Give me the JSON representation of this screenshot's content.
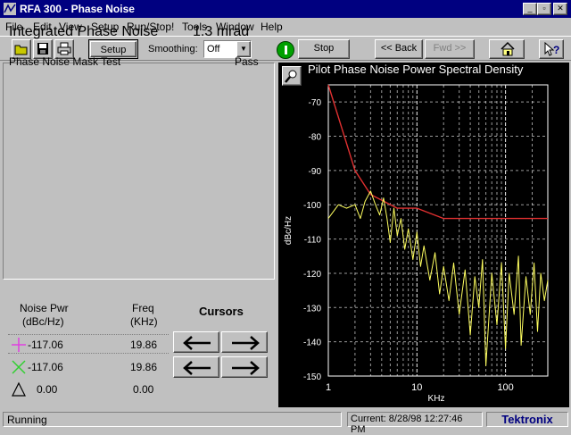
{
  "window": {
    "title": "RFA 300 - Phase Noise"
  },
  "menu": [
    "File",
    "Edit",
    "View",
    "Setup",
    "Run/Stop!",
    "Tools",
    "Window",
    "Help"
  ],
  "toolbar": {
    "setup_label": "Setup",
    "smoothing_label": "Smoothing:",
    "smoothing_value": "Off",
    "stop_label": "Stop",
    "back_label": "<< Back",
    "fwd_label": "Fwd >>"
  },
  "results": {
    "integrated_label": "Integrated Phase Noise",
    "integrated_value": "1.3 mrad",
    "mask_label": "Phase Noise Mask Test",
    "mask_result": "Pass"
  },
  "cursors": {
    "col_noise_line1": "Noise Pwr",
    "col_noise_line2": "(dBc/Hz)",
    "col_freq_line1": "Freq",
    "col_freq_line2": "(KHz)",
    "title": "Cursors",
    "rows": [
      {
        "marker": "plus",
        "noise": "-117.06",
        "freq": "19.86"
      },
      {
        "marker": "x",
        "noise": "-117.06",
        "freq": "19.86"
      },
      {
        "marker": "delta",
        "noise": "0.00",
        "freq": "0.00"
      }
    ]
  },
  "status": {
    "text": "Running",
    "current": "Current: 8/28/98 12:27:46 PM",
    "brand": "Tektronix"
  },
  "colors": {
    "titlebar": "#000080",
    "mask": "#e03030",
    "trace": "#ffff60",
    "grid": "#ffffff"
  },
  "chart_data": {
    "type": "line",
    "title": "Pilot Phase Noise Power Spectral Density",
    "xlabel": "KHz",
    "ylabel": "dBc/Hz",
    "xscale": "log",
    "xlim": [
      1,
      300
    ],
    "ylim": [
      -150,
      -65
    ],
    "xticks": [
      "1",
      "10",
      "100"
    ],
    "yticks": [
      -70,
      -80,
      -90,
      -100,
      -110,
      -120,
      -130,
      -140,
      -150
    ],
    "series": [
      {
        "points": [
          [
            1,
            -65
          ],
          [
            2,
            -90
          ],
          [
            3,
            -97
          ],
          [
            6,
            -101
          ],
          [
            10,
            -101
          ],
          [
            20,
            -104
          ],
          [
            300,
            -104
          ]
        ]
      },
      {
        "points": [
          [
            1,
            -104
          ],
          [
            1.3,
            -100
          ],
          [
            1.6,
            -101
          ],
          [
            2,
            -100
          ],
          [
            2.3,
            -104
          ],
          [
            2.6,
            -99
          ],
          [
            3,
            -96
          ],
          [
            3.4,
            -100
          ],
          [
            3.8,
            -103
          ],
          [
            4.2,
            -98
          ],
          [
            4.6,
            -104
          ],
          [
            5,
            -111
          ],
          [
            5.5,
            -101
          ],
          [
            6,
            -109
          ],
          [
            6.6,
            -104
          ],
          [
            7.3,
            -113
          ],
          [
            8,
            -107
          ],
          [
            9,
            -116
          ],
          [
            10,
            -108
          ],
          [
            11,
            -118
          ],
          [
            12,
            -112
          ],
          [
            14,
            -122
          ],
          [
            16,
            -114
          ],
          [
            18,
            -126
          ],
          [
            20,
            -118
          ],
          [
            23,
            -128
          ],
          [
            26,
            -117
          ],
          [
            30,
            -132
          ],
          [
            35,
            -119
          ],
          [
            40,
            -138
          ],
          [
            45,
            -121
          ],
          [
            50,
            -130
          ],
          [
            55,
            -116
          ],
          [
            60,
            -147
          ],
          [
            70,
            -120
          ],
          [
            80,
            -135
          ],
          [
            90,
            -117
          ],
          [
            100,
            -142
          ],
          [
            110,
            -120
          ],
          [
            125,
            -132
          ],
          [
            140,
            -115
          ],
          [
            150,
            -141
          ],
          [
            170,
            -121
          ],
          [
            190,
            -132
          ],
          [
            210,
            -117
          ],
          [
            230,
            -137
          ],
          [
            250,
            -120
          ],
          [
            275,
            -128
          ],
          [
            300,
            -122
          ]
        ]
      }
    ]
  }
}
